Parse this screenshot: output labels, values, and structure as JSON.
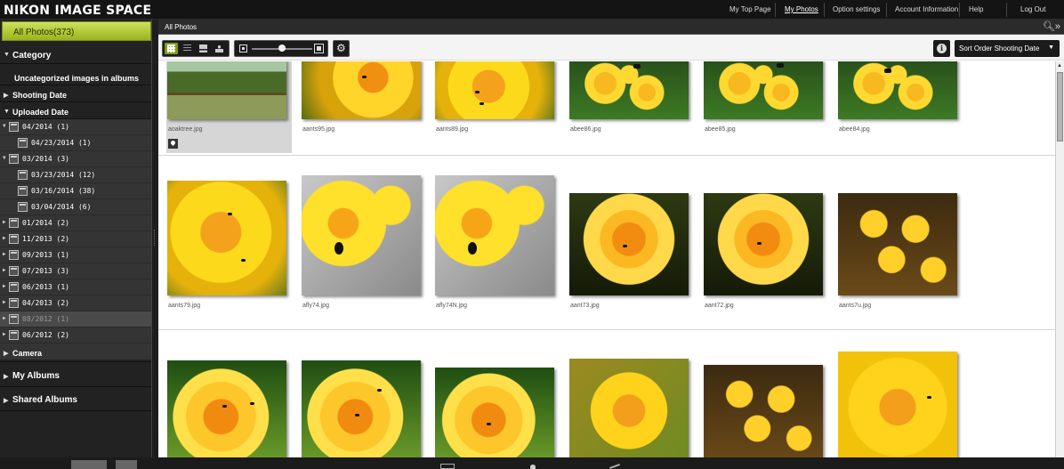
{
  "app": {
    "title": "NIKON IMAGE SPACE"
  },
  "topnav": {
    "items": [
      {
        "label": "My Top Page"
      },
      {
        "label": "My Photos"
      },
      {
        "label": "Option settings"
      },
      {
        "label": "Account Information"
      },
      {
        "label": "Help"
      },
      {
        "label": "Log Out"
      }
    ]
  },
  "sidebar": {
    "all_photos": "All Photos(373)",
    "category": "Category",
    "uncategorized": "Uncategorized images in albums",
    "shooting_date": "Shooting Date",
    "uploaded_date": "Uploaded Date",
    "dates": [
      {
        "label": "04/2014 (1)"
      },
      {
        "label": "04/23/2014 (1)"
      },
      {
        "label": "03/2014 (3)"
      },
      {
        "label": "03/23/2014 (12)"
      },
      {
        "label": "03/16/2014 (38)"
      },
      {
        "label": "03/04/2014 (6)"
      },
      {
        "label": "01/2014 (2)"
      },
      {
        "label": "11/2013 (2)"
      },
      {
        "label": "09/2013 (1)"
      },
      {
        "label": "07/2013 (3)"
      },
      {
        "label": "06/2013 (1)"
      },
      {
        "label": "04/2013 (2)"
      },
      {
        "label": "08/2012 (1)"
      },
      {
        "label": "06/2012 (2)"
      }
    ],
    "camera": "Camera",
    "my_albums": "My Albums",
    "shared_albums": "Shared Albums"
  },
  "main": {
    "title": "All Photos",
    "sort_label": "Sort Order Shooting Date",
    "rows": [
      {
        "items": [
          {
            "name": "aoaktree.jpg"
          },
          {
            "name": "aants95.jpg"
          },
          {
            "name": "aants89.jpg"
          },
          {
            "name": "abee86.jpg"
          },
          {
            "name": "abee85.jpg"
          },
          {
            "name": "abee84.jpg"
          }
        ]
      },
      {
        "items": [
          {
            "name": "aants79.jpg"
          },
          {
            "name": "afly74.jpg"
          },
          {
            "name": "afly74N.jpg"
          },
          {
            "name": "aant73.jpg"
          },
          {
            "name": "aant72.jpg"
          },
          {
            "name": "aants7u.jpg"
          }
        ]
      },
      {
        "items": [
          {
            "name": ""
          },
          {
            "name": ""
          },
          {
            "name": ""
          },
          {
            "name": ""
          },
          {
            "name": ""
          },
          {
            "name": ""
          }
        ]
      }
    ]
  }
}
